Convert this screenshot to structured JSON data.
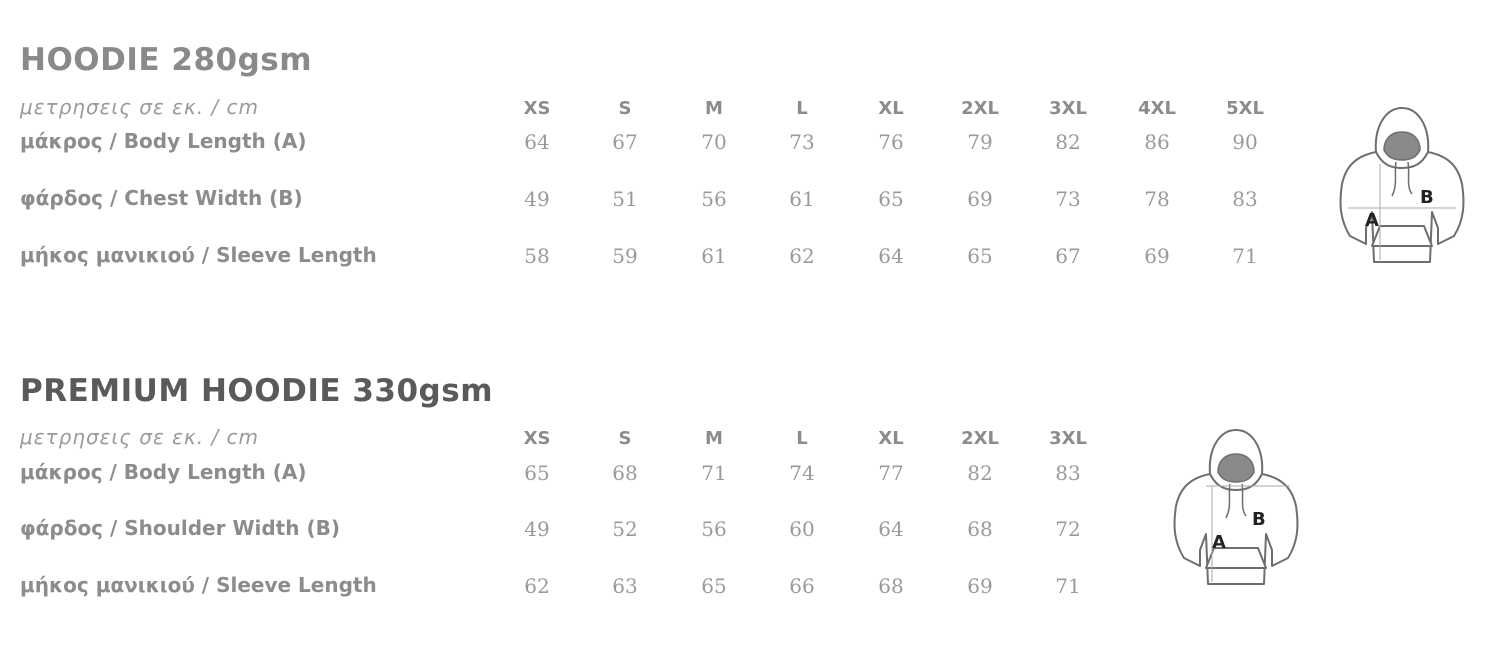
{
  "tables": [
    {
      "title": "HOODIE 280gsm",
      "units": "μετρησεις σε εκ. / cm",
      "sizes": [
        "XS",
        "S",
        "M",
        "L",
        "XL",
        "2XL",
        "3XL",
        "4XL",
        "5XL"
      ],
      "rows": [
        {
          "label": "μάκρος / Body Length (A)",
          "values": [
            "64",
            "67",
            "70",
            "73",
            "76",
            "79",
            "82",
            "86",
            "90"
          ]
        },
        {
          "label": "φάρδος / Chest Width (B)",
          "values": [
            "49",
            "51",
            "56",
            "61",
            "65",
            "69",
            "73",
            "78",
            "83"
          ]
        },
        {
          "label": "μήκος μανικιού / Sleeve Length",
          "values": [
            "58",
            "59",
            "61",
            "62",
            "64",
            "65",
            "67",
            "69",
            "71"
          ]
        }
      ],
      "diagram": {
        "label_a": "A",
        "label_b": "B",
        "icon": "hoodie-icon"
      }
    },
    {
      "title": "PREMIUM HOODIE 330gsm",
      "units": "μετρησεις σε εκ. / cm",
      "sizes": [
        "XS",
        "S",
        "M",
        "L",
        "XL",
        "2XL",
        "3XL"
      ],
      "rows": [
        {
          "label": "μάκρος / Body Length (A)",
          "values": [
            "65",
            "68",
            "71",
            "74",
            "77",
            "82",
            "83"
          ]
        },
        {
          "label": "φάρδος / Shoulder Width (B)",
          "values": [
            "49",
            "52",
            "56",
            "60",
            "64",
            "68",
            "72"
          ]
        },
        {
          "label": "μήκος μανικιού / Sleeve Length",
          "values": [
            "62",
            "63",
            "65",
            "66",
            "68",
            "69",
            "71"
          ]
        }
      ],
      "diagram": {
        "label_a": "A",
        "label_b": "B",
        "icon": "hoodie-icon"
      }
    }
  ]
}
